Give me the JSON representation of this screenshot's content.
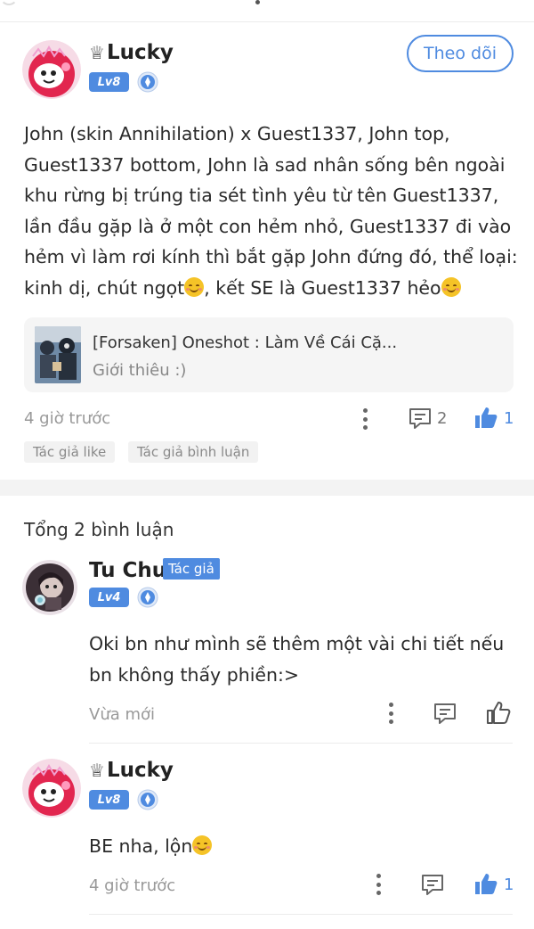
{
  "post": {
    "user": {
      "name": "Lucky",
      "crown": "♕",
      "level": "Lv8"
    },
    "follow_label": "Theo dõi",
    "text_parts": [
      "John (skin Annihilation) x Guest1337, John top, Guest1337 bottom, John là sad nhân sống bên ngoài khu rừng bị trúng tia sét tình yêu từ tên Guest1337, lần đầu gặp là ở một con hẻm nhỏ, Guest1337 đi vào hẻm vì làm rơi kính thì bắt gặp John đứng đó, thể loại: kinh dị, chút ngọt",
      ", kết SE là Guest1337 hẻo"
    ],
    "card": {
      "title": "[Forsaken] Oneshot : Làm Về Cái Cặ...",
      "subtitle": "Giới thiêu :)"
    },
    "time": "4 giờ trước",
    "comment_count": "2",
    "like_count": "1",
    "tags": [
      "Tác giả like",
      "Tác giả bình luận"
    ]
  },
  "comments_header": "Tổng 2 bình luận",
  "comments": [
    {
      "user": {
        "name": "Tu Chu",
        "level": "Lv4",
        "badge": "Tác giả"
      },
      "text": "Oki bn như mình sẽ thêm một vài chi tiết nếu bn không thấy phiền:>",
      "time": "Vừa mới",
      "like_count": ""
    },
    {
      "user": {
        "name": "Lucky",
        "crown": "♕",
        "level": "Lv8"
      },
      "text": "BE nha, lộn",
      "time": "4 giờ trước",
      "like_count": "1"
    }
  ],
  "colors": {
    "accent": "#4f8be0",
    "muted": "#999999",
    "tag_bg": "#f2f2f2"
  },
  "icons": [
    "more-vertical-icon",
    "comment-icon",
    "thumbs-up-icon",
    "medal-icon",
    "crown-icon",
    "smile-emoji-icon"
  ]
}
